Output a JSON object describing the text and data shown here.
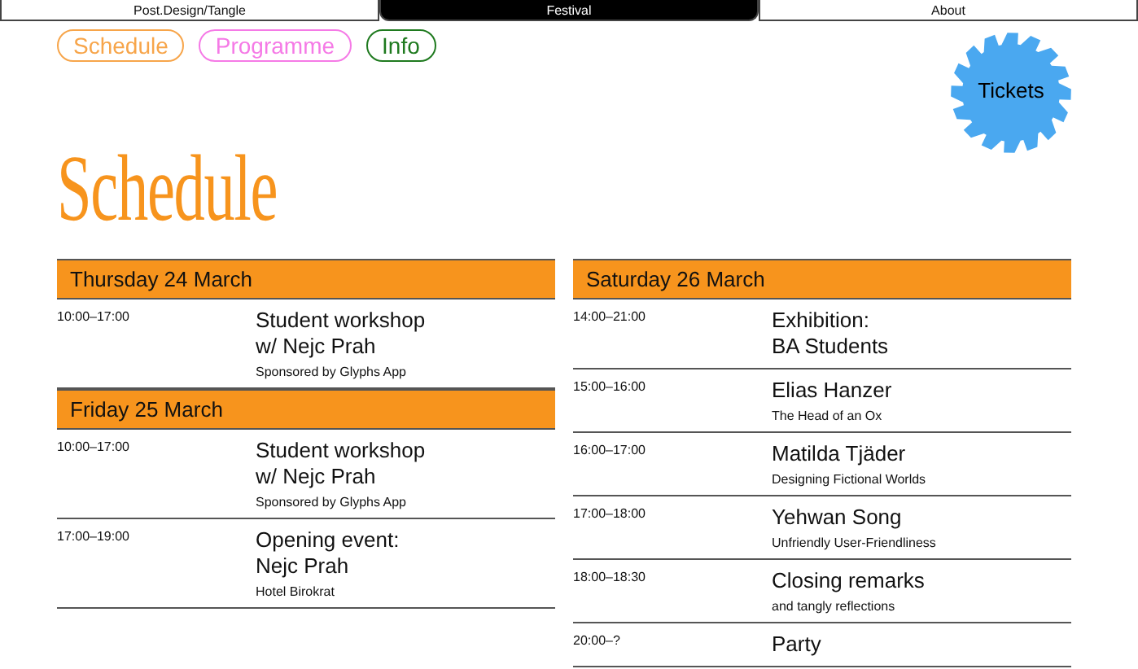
{
  "nav": [
    {
      "label": "Post.Design/Tangle",
      "selected": false
    },
    {
      "label": "Festival",
      "selected": true
    },
    {
      "label": "About",
      "selected": false
    }
  ],
  "pills": [
    {
      "label": "Schedule",
      "color": "#f7a54a"
    },
    {
      "label": "Programme",
      "color": "#f57ae6"
    },
    {
      "label": "Info",
      "color": "#1f7a1f"
    }
  ],
  "tickets": "Tickets",
  "heading": "Schedule",
  "columns": [
    {
      "days": [
        {
          "title": "Thursday 24 March",
          "events": [
            {
              "time": "10:00–17:00",
              "title_lines": [
                "Student workshop",
                "w/ Nejc Prah"
              ],
              "note": "Sponsored by Glyphs App"
            }
          ]
        },
        {
          "title": "Friday 25 March",
          "events": [
            {
              "time": "10:00–17:00",
              "title_lines": [
                "Student workshop",
                "w/ Nejc Prah"
              ],
              "note": "Sponsored by Glyphs App"
            },
            {
              "time": "17:00–19:00",
              "title_lines": [
                "Opening event:",
                "Nejc Prah"
              ],
              "note": "Hotel Birokrat"
            }
          ]
        }
      ]
    },
    {
      "days": [
        {
          "title": "Saturday 26 March",
          "events": [
            {
              "time": "14:00–21:00",
              "title_lines": [
                "Exhibition:",
                "BA Students"
              ]
            },
            {
              "time": "15:00–16:00",
              "title_lines": [
                "Elias Hanzer"
              ],
              "note": "The Head of an Ox"
            },
            {
              "time": "16:00–17:00",
              "title_lines": [
                "Matilda Tjäder"
              ],
              "note": "Designing Fictional Worlds"
            },
            {
              "time": "17:00–18:00",
              "title_lines": [
                "Yehwan Song"
              ],
              "note": "Unfriendly User-Friendliness"
            },
            {
              "time": "18:00–18:30",
              "title_lines": [
                "Closing remarks"
              ],
              "note": "and tangly reflections"
            },
            {
              "time": "20:00–?",
              "title_lines": [
                "Party"
              ]
            }
          ]
        }
      ]
    }
  ]
}
